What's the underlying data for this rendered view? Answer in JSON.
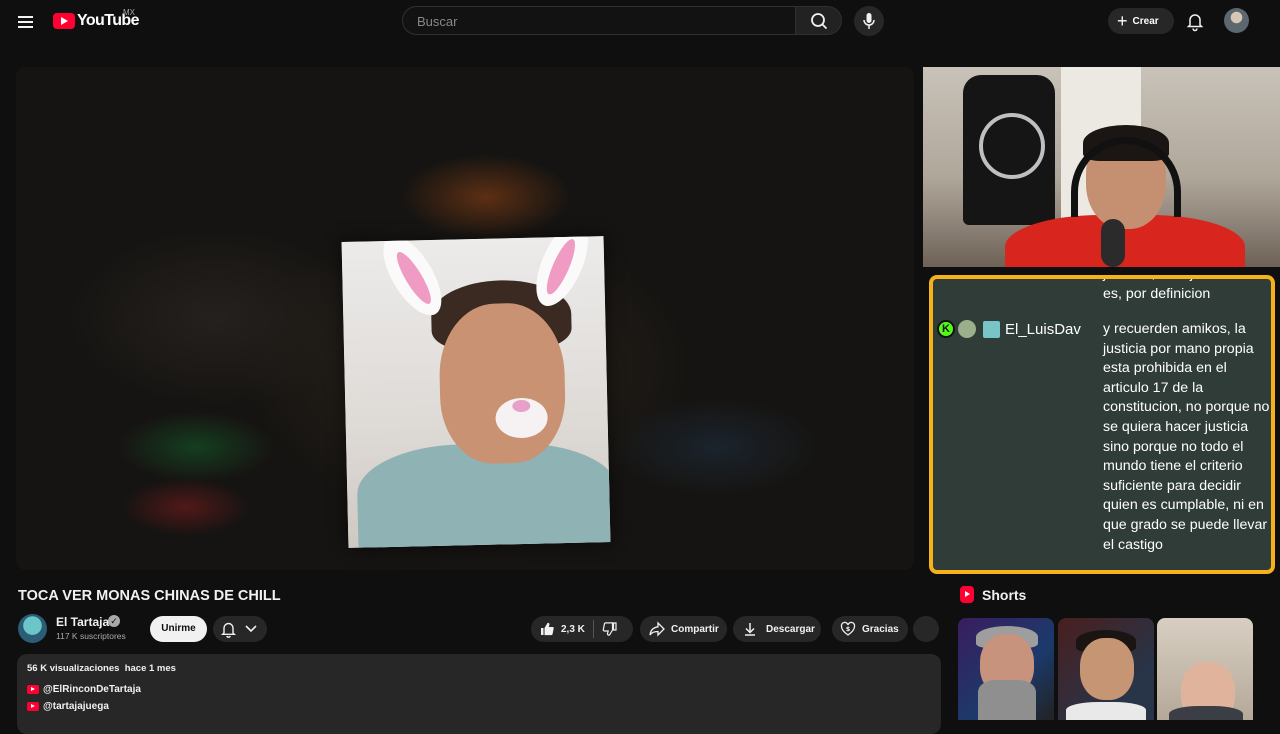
{
  "header": {
    "logo_text": "YouTube",
    "country_code": "MX",
    "search_placeholder": "Buscar",
    "create_label": "Crear"
  },
  "video": {
    "title": "TOCA VER MONAS CHINAS DE CHILL"
  },
  "chat_overlay": {
    "previous_message_tail": "justicia\", o es justicia o no es, por definicion",
    "username": "El_LuisDav",
    "badge_letter": "K",
    "message": "y recuerden amikos, la justicia por mano propia esta prohibida en el articulo 17 de la constitucion, no porque no se quiera hacer justicia sino porque no todo el mundo tiene el criterio suficiente para decidir quien es cumplable, ni en que grado se puede llevar el castigo",
    "border_color": "#f5b21b"
  },
  "channel": {
    "name": "El Tartaja",
    "subscribers": "117 K suscriptores",
    "join_label": "Unirme"
  },
  "actions": {
    "like_count": "2,3 K",
    "share_label": "Compartir",
    "download_label": "Descargar",
    "thanks_label": "Gracias"
  },
  "description": {
    "views": "56 K visualizaciones",
    "date": "hace 1 mes",
    "links": [
      "@ElRinconDeTartaja",
      "@tartajajuega"
    ]
  },
  "shorts": {
    "title": "Shorts"
  },
  "colors": {
    "brand": "#ff0033",
    "background": "#0f0f0f",
    "chip": "#272727"
  }
}
